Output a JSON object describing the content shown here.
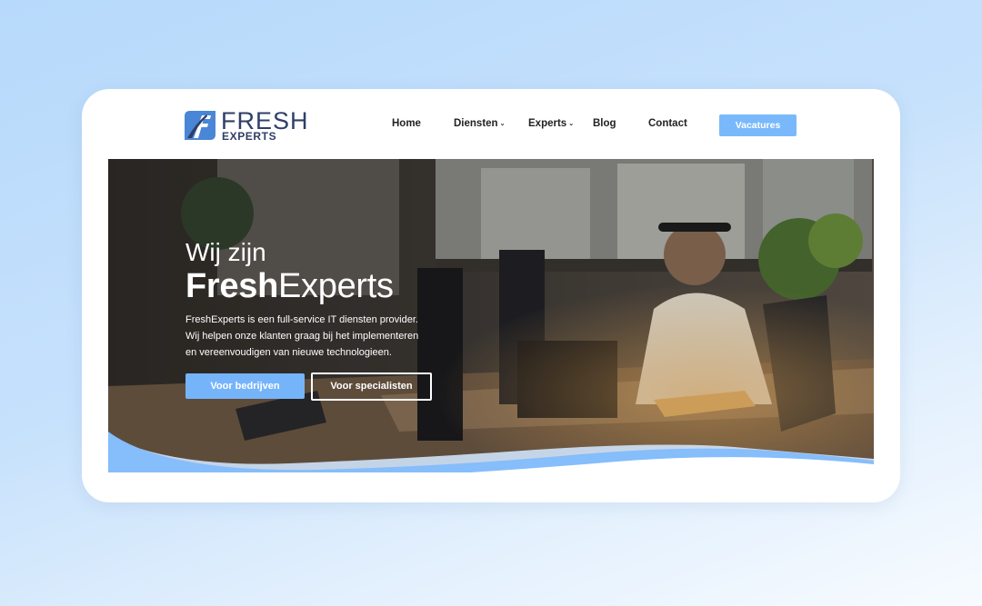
{
  "logo": {
    "brand": "FRESH",
    "sub": "EXPERTS"
  },
  "nav": {
    "home": "Home",
    "diensten": "Diensten",
    "experts": "Experts",
    "blog": "Blog",
    "contact": "Contact",
    "caret": "⌄"
  },
  "cta": {
    "label": "Vacatures"
  },
  "hero": {
    "line1": "Wij zijn",
    "brand_bold": "Fresh",
    "brand_light": "Experts",
    "description": "FreshExperts is een full-service IT diensten provider. Wij helpen onze klanten graag bij het implementeren en vereenvoudigen van nieuwe technologieen.",
    "button_primary": "Voor bedrijven",
    "button_secondary": "Voor specialisten"
  },
  "colors": {
    "accent": "#79b9fb",
    "brand_navy": "#2f3f68",
    "brand_blue": "#4a86d6"
  },
  "icons": [
    "freshexperts-logo-icon",
    "chevron-down-icon"
  ]
}
